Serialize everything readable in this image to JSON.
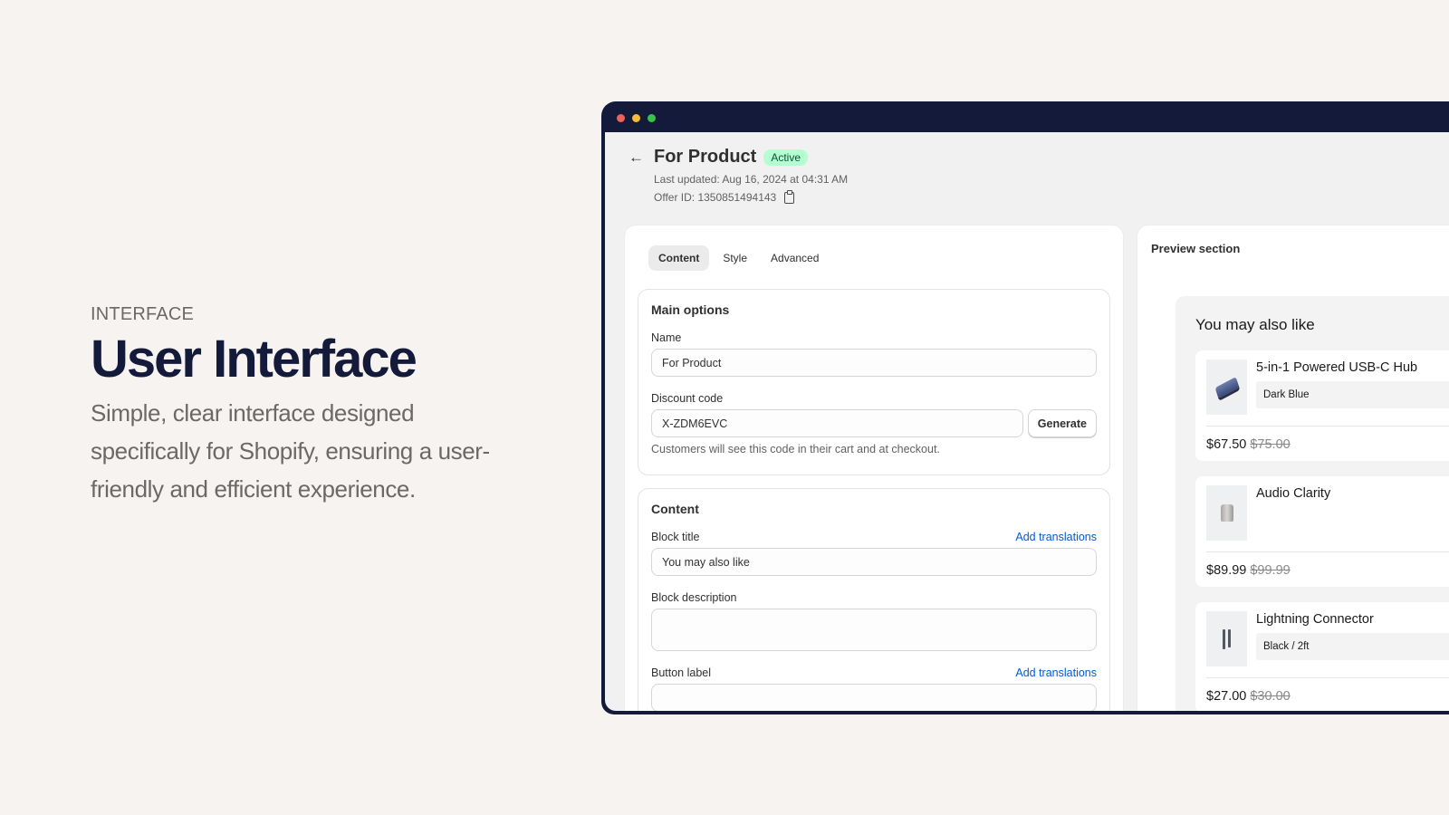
{
  "hero": {
    "eyebrow": "INTERFACE",
    "title": "User Interface",
    "description": "Simple, clear interface designed specifically for Shopify, ensuring a user-friendly and efficient experience."
  },
  "window": {
    "controls": [
      "close",
      "minimize",
      "maximize"
    ]
  },
  "page": {
    "title": "For Product",
    "status_badge": "Active",
    "last_updated": "Last updated: Aug 16, 2024 at 04:31 AM",
    "offer_id": "Offer ID: 1350851494143",
    "back_icon": "arrow-left-icon",
    "copy_icon": "clipboard-icon"
  },
  "tabs": [
    {
      "label": "Content",
      "active": true
    },
    {
      "label": "Style",
      "active": false
    },
    {
      "label": "Advanced",
      "active": false
    }
  ],
  "main_options": {
    "title": "Main options",
    "name_label": "Name",
    "name_value": "For Product",
    "discount_label": "Discount code",
    "discount_value": "X-ZDM6EVC",
    "generate_button": "Generate",
    "discount_help": "Customers will see this code in their cart and at checkout."
  },
  "content_section": {
    "title": "Content",
    "block_title_label": "Block title",
    "block_title_value": "You may also like",
    "block_description_label": "Block description",
    "block_description_value": "",
    "button_label_label": "Button label",
    "add_translations": "Add translations"
  },
  "preview": {
    "title": "Preview section",
    "heading": "You may also like",
    "products": [
      {
        "name": "5-in-1 Powered USB-C Hub",
        "variant": "Dark Blue",
        "price": "$67.50",
        "compare_price": "$75.00",
        "image": "usb-hub-image"
      },
      {
        "name": "Audio Clarity",
        "variant": "",
        "price": "$89.99",
        "compare_price": "$99.99",
        "image": "speaker-image"
      },
      {
        "name": "Lightning Connector",
        "variant": "Black / 2ft",
        "price": "$27.00",
        "compare_price": "$30.00",
        "image": "cable-image"
      }
    ]
  },
  "colors": {
    "background": "#f6f3f0",
    "navy": "#131a3a",
    "badge_bg": "#b4fed2",
    "link": "#005bd3"
  }
}
